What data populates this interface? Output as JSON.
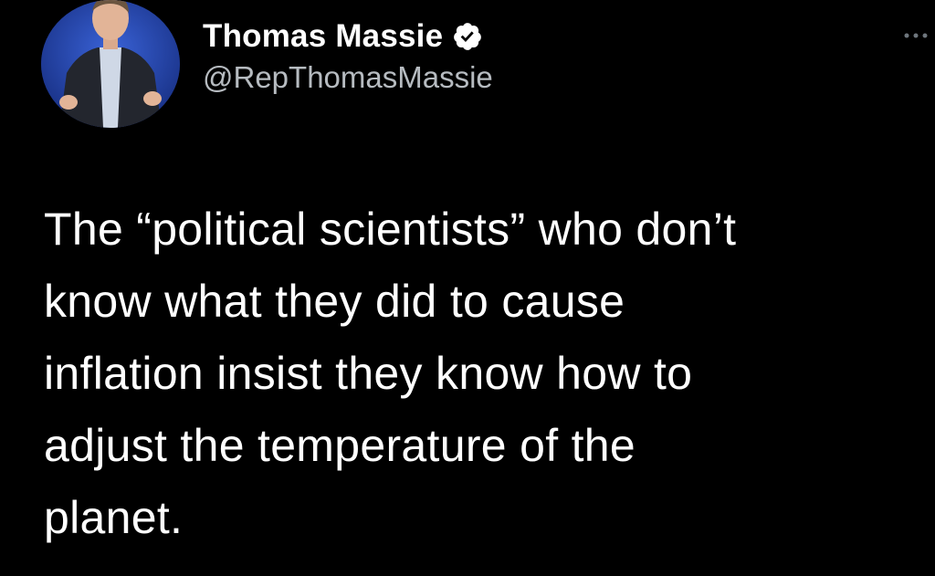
{
  "tweet": {
    "author": {
      "display_name": "Thomas Massie",
      "handle": "@RepThomasMassie",
      "verified": true,
      "avatar": "profile-photo",
      "verified_icon": "verified-badge-icon"
    },
    "more_icon": "more-options-icon",
    "text_lines": [
      "The “political scientists” who don’t",
      "know what they did to cause",
      "inflation insist they know how to",
      "adjust the temperature of the",
      "planet."
    ]
  },
  "colors": {
    "background": "#000000",
    "text": "#ffffff",
    "handle": "#b6bbc0",
    "verified_badge": "#ffffff"
  }
}
